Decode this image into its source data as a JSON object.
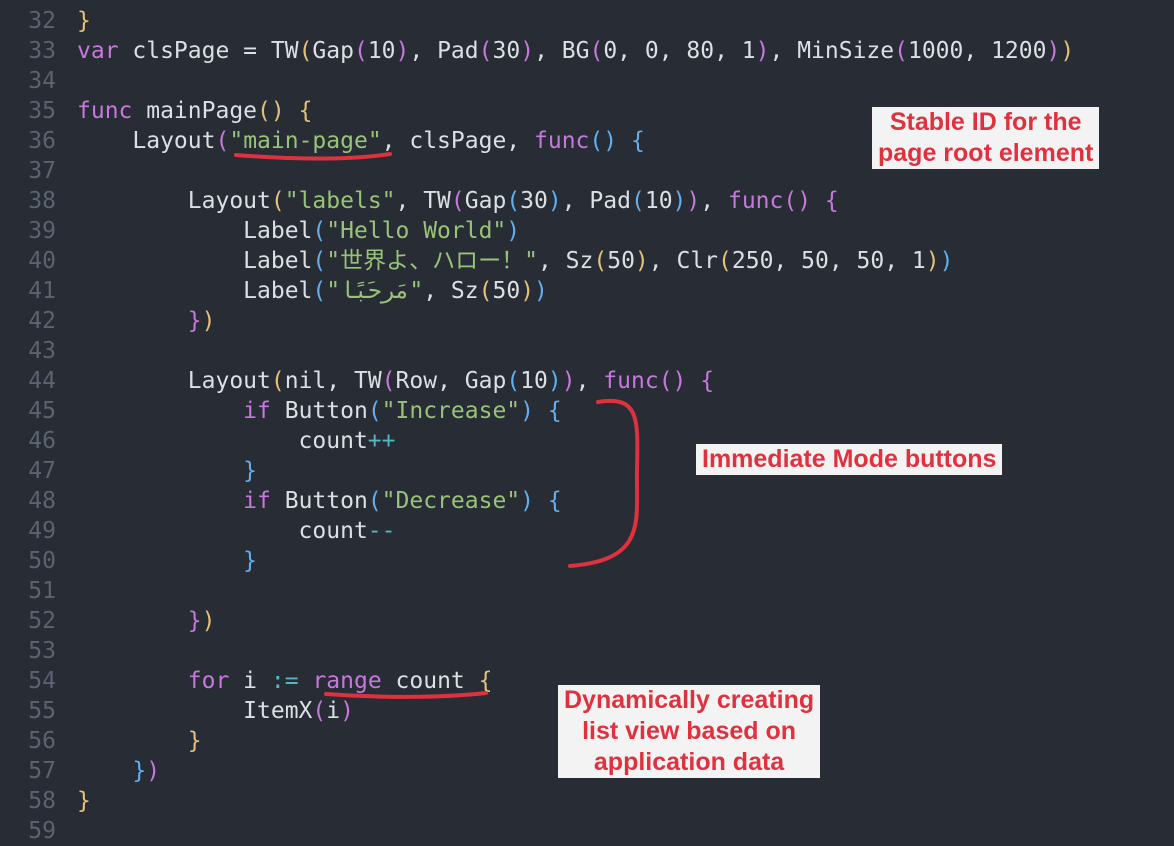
{
  "editor": {
    "lines": [
      {
        "n": "32",
        "t": [
          [
            "p1",
            "}"
          ]
        ]
      },
      {
        "n": "33",
        "t": [
          [
            "kw",
            "var"
          ],
          [
            "plain",
            " clsPage = TW"
          ],
          [
            "p1",
            "("
          ],
          [
            "plain",
            "Gap"
          ],
          [
            "p2",
            "("
          ],
          [
            "num",
            "10"
          ],
          [
            "p2",
            ")"
          ],
          [
            "plain",
            ", Pad"
          ],
          [
            "p2",
            "("
          ],
          [
            "num",
            "30"
          ],
          [
            "p2",
            ")"
          ],
          [
            "plain",
            ", BG"
          ],
          [
            "p2",
            "("
          ],
          [
            "num",
            "0, 0, 80, 1"
          ],
          [
            "p2",
            ")"
          ],
          [
            "plain",
            ", MinSize"
          ],
          [
            "p2",
            "("
          ],
          [
            "num",
            "1000, 1200"
          ],
          [
            "p2",
            ")"
          ],
          [
            "p1",
            ")"
          ]
        ]
      },
      {
        "n": "34",
        "t": []
      },
      {
        "n": "35",
        "t": [
          [
            "kw",
            "func"
          ],
          [
            "plain",
            " mainPage"
          ],
          [
            "p1",
            "()"
          ],
          [
            "plain",
            " "
          ],
          [
            "p1",
            "{"
          ]
        ]
      },
      {
        "n": "36",
        "t": [
          [
            "plain",
            "    Layout"
          ],
          [
            "p2",
            "("
          ],
          [
            "str",
            "\"main-page\""
          ],
          [
            "plain",
            ", clsPage, "
          ],
          [
            "kw",
            "func"
          ],
          [
            "p3",
            "()"
          ],
          [
            "plain",
            " "
          ],
          [
            "p3",
            "{"
          ]
        ]
      },
      {
        "n": "37",
        "t": []
      },
      {
        "n": "38",
        "t": [
          [
            "plain",
            "        Layout"
          ],
          [
            "p1",
            "("
          ],
          [
            "str",
            "\"labels\""
          ],
          [
            "plain",
            ", TW"
          ],
          [
            "p2",
            "("
          ],
          [
            "plain",
            "Gap"
          ],
          [
            "p3",
            "("
          ],
          [
            "num",
            "30"
          ],
          [
            "p3",
            ")"
          ],
          [
            "plain",
            ", Pad"
          ],
          [
            "p3",
            "("
          ],
          [
            "num",
            "10"
          ],
          [
            "p3",
            ")"
          ],
          [
            "p2",
            ")"
          ],
          [
            "plain",
            ", "
          ],
          [
            "kw",
            "func"
          ],
          [
            "p2",
            "()"
          ],
          [
            "plain",
            " "
          ],
          [
            "p2",
            "{"
          ]
        ]
      },
      {
        "n": "39",
        "t": [
          [
            "plain",
            "            Label"
          ],
          [
            "p3",
            "("
          ],
          [
            "str",
            "\"Hello World\""
          ],
          [
            "p3",
            ")"
          ]
        ]
      },
      {
        "n": "40",
        "t": [
          [
            "plain",
            "            Label"
          ],
          [
            "p3",
            "("
          ],
          [
            "str",
            "\"世界よ、ハロー！\""
          ],
          [
            "plain",
            ", Sz"
          ],
          [
            "p1",
            "("
          ],
          [
            "num",
            "50"
          ],
          [
            "p1",
            ")"
          ],
          [
            "plain",
            ", Clr"
          ],
          [
            "p1",
            "("
          ],
          [
            "num",
            "250, 50, 50, 1"
          ],
          [
            "p1",
            ")"
          ],
          [
            "p3",
            ")"
          ]
        ]
      },
      {
        "n": "41",
        "t": [
          [
            "plain",
            "            Label"
          ],
          [
            "p3",
            "("
          ],
          [
            "str",
            "\"مَرحَبًا\""
          ],
          [
            "plain",
            ", Sz"
          ],
          [
            "p1",
            "("
          ],
          [
            "num",
            "50"
          ],
          [
            "p1",
            ")"
          ],
          [
            "p3",
            ")"
          ]
        ]
      },
      {
        "n": "42",
        "t": [
          [
            "plain",
            "        "
          ],
          [
            "p2",
            "}"
          ],
          [
            "p1",
            ")"
          ]
        ]
      },
      {
        "n": "43",
        "t": []
      },
      {
        "n": "44",
        "t": [
          [
            "plain",
            "        Layout"
          ],
          [
            "p1",
            "("
          ],
          [
            "plain",
            "nil, TW"
          ],
          [
            "p2",
            "("
          ],
          [
            "plain",
            "Row, Gap"
          ],
          [
            "p3",
            "("
          ],
          [
            "num",
            "10"
          ],
          [
            "p3",
            ")"
          ],
          [
            "p2",
            ")"
          ],
          [
            "plain",
            ", "
          ],
          [
            "kw",
            "func"
          ],
          [
            "p2",
            "()"
          ],
          [
            "plain",
            " "
          ],
          [
            "p2",
            "{"
          ]
        ]
      },
      {
        "n": "45",
        "t": [
          [
            "plain",
            "            "
          ],
          [
            "kw",
            "if"
          ],
          [
            "plain",
            " Button"
          ],
          [
            "p3",
            "("
          ],
          [
            "str",
            "\"Increase\""
          ],
          [
            "p3",
            ")"
          ],
          [
            "plain",
            " "
          ],
          [
            "p3",
            "{"
          ]
        ]
      },
      {
        "n": "46",
        "t": [
          [
            "plain",
            "                count"
          ],
          [
            "op",
            "++"
          ]
        ]
      },
      {
        "n": "47",
        "t": [
          [
            "plain",
            "            "
          ],
          [
            "p3",
            "}"
          ]
        ]
      },
      {
        "n": "48",
        "t": [
          [
            "plain",
            "            "
          ],
          [
            "kw",
            "if"
          ],
          [
            "plain",
            " Button"
          ],
          [
            "p3",
            "("
          ],
          [
            "str",
            "\"Decrease\""
          ],
          [
            "p3",
            ")"
          ],
          [
            "plain",
            " "
          ],
          [
            "p3",
            "{"
          ]
        ]
      },
      {
        "n": "49",
        "t": [
          [
            "plain",
            "                count"
          ],
          [
            "op",
            "--"
          ]
        ]
      },
      {
        "n": "50",
        "t": [
          [
            "plain",
            "            "
          ],
          [
            "p3",
            "}"
          ]
        ]
      },
      {
        "n": "51",
        "t": []
      },
      {
        "n": "52",
        "t": [
          [
            "plain",
            "        "
          ],
          [
            "p2",
            "}"
          ],
          [
            "p1",
            ")"
          ]
        ]
      },
      {
        "n": "53",
        "t": []
      },
      {
        "n": "54",
        "t": [
          [
            "plain",
            "        "
          ],
          [
            "kw",
            "for"
          ],
          [
            "plain",
            " i "
          ],
          [
            "op",
            ":="
          ],
          [
            "plain",
            " "
          ],
          [
            "kw",
            "range"
          ],
          [
            "plain",
            " count "
          ],
          [
            "p1",
            "{"
          ]
        ]
      },
      {
        "n": "55",
        "t": [
          [
            "plain",
            "            ItemX"
          ],
          [
            "p2",
            "("
          ],
          [
            "plain",
            "i"
          ],
          [
            "p2",
            ")"
          ]
        ]
      },
      {
        "n": "56",
        "t": [
          [
            "plain",
            "        "
          ],
          [
            "p1",
            "}"
          ]
        ]
      },
      {
        "n": "57",
        "t": [
          [
            "plain",
            "    "
          ],
          [
            "p3",
            "}"
          ],
          [
            "p2",
            ")"
          ]
        ]
      },
      {
        "n": "58",
        "t": [
          [
            "p1",
            "}"
          ]
        ]
      },
      {
        "n": "59",
        "t": []
      }
    ]
  },
  "annotations": {
    "stable_id": [
      "Stable ID for the",
      "page root element"
    ],
    "immediate_mode": [
      "Immediate Mode buttons"
    ],
    "dynamic_list": [
      "Dynamically creating",
      "list view based on",
      "application data"
    ]
  },
  "colors": {
    "background": "#282c34",
    "annotation_red": "#e0313f",
    "annotation_bg": "#f3f3f3"
  }
}
